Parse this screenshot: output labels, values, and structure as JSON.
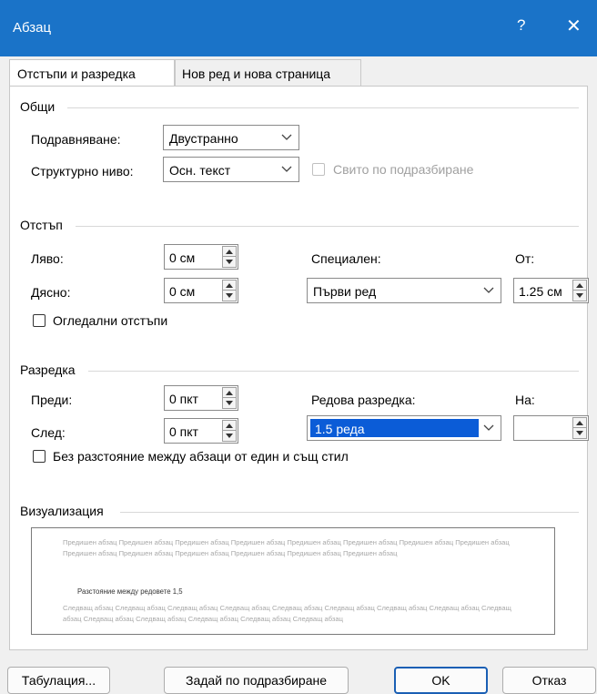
{
  "dialog": {
    "title": "Абзац",
    "help": "?",
    "close": "✕"
  },
  "tabs": [
    {
      "label": "Отстъпи и разредка",
      "active": true
    },
    {
      "label": "Нов ред и нова страница",
      "active": false
    }
  ],
  "general": {
    "title": "Общи",
    "alignment_label": "Подравняване:",
    "alignment_value": "Двустранно",
    "outline_label": "Структурно ниво:",
    "outline_value": "Осн. текст",
    "collapsed_label": "Свито по подразбиране"
  },
  "indent": {
    "title": "Отстъп",
    "left_label": "Ляво:",
    "left_value": "0 см",
    "right_label": "Дясно:",
    "right_value": "0 см",
    "special_label": "Специален:",
    "special_value": "Първи ред",
    "by_label": "От:",
    "by_value": "1.25 см",
    "mirror_label": "Огледални отстъпи"
  },
  "spacing": {
    "title": "Разредка",
    "before_label": "Преди:",
    "before_value": "0 пкт",
    "after_label": "След:",
    "after_value": "0 пкт",
    "line_label": "Редова разредка:",
    "line_value": "1.5 реда",
    "at_label": "На:",
    "at_value": "",
    "no_space_label": "Без разстояние между абзаци от един и същ стил"
  },
  "preview": {
    "title": "Визуализация",
    "prev_text": "Предишен абзац Предишен абзац Предишен абзац Предишен абзац Предишен абзац Предишен абзац Предишен абзац Предишен абзац Предишен абзац Предишен абзац Предишен абзац Предишен абзац Предишен абзац Предишен абзац",
    "current_text": "Разстояние между редовете 1,5",
    "next_text": "Следващ абзац Следващ абзац Следващ абзац Следващ абзац Следващ абзац Следващ абзац Следващ абзац Следващ абзац Следващ абзац Следващ абзац Следващ абзац Следващ абзац Следващ абзац Следващ абзац"
  },
  "buttons": {
    "tabs": "Табулация...",
    "set_default": "Задай по подразбиране",
    "ok": "OK",
    "cancel": "Отказ"
  },
  "colors": {
    "titlebar": "#1a73c8",
    "selection": "#0b5cd7"
  }
}
